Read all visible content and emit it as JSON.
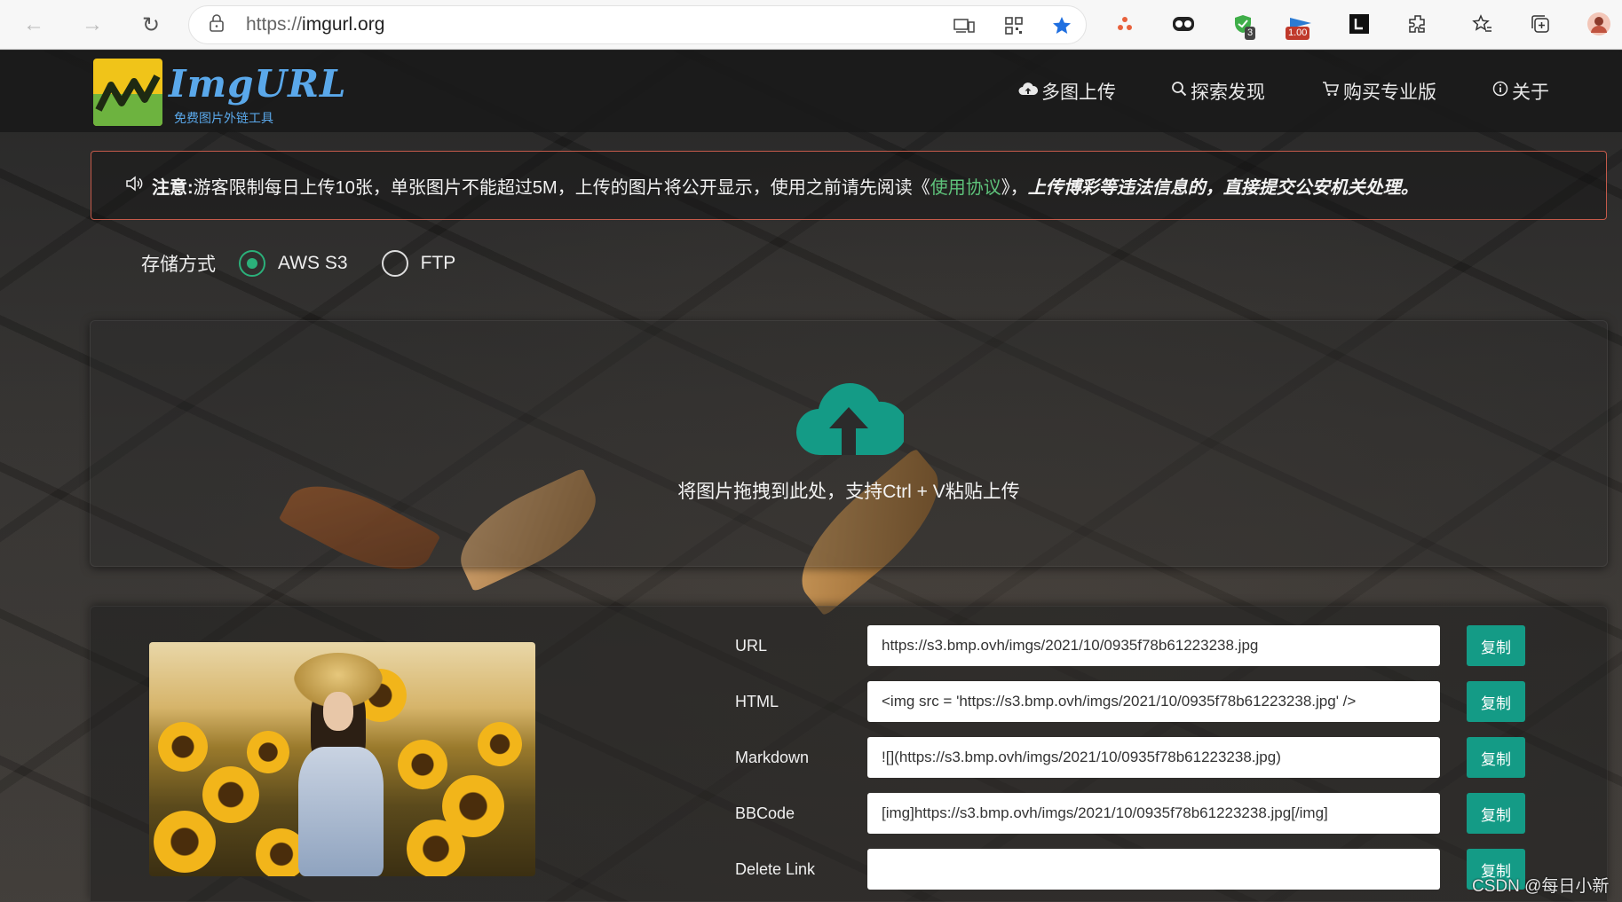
{
  "browser": {
    "url_protocol": "https://",
    "url_host": "imgurl.org",
    "extension_badge_count": "3",
    "extension_badge_zoom": "1.00"
  },
  "site": {
    "logo_title": "ImgURL",
    "logo_subtitle": "免费图片外链工具",
    "menu": {
      "multi_upload": "多图上传",
      "explore": "探索发现",
      "buy_pro": "购买专业版",
      "about": "关于"
    }
  },
  "notice": {
    "label": "注意:",
    "text_before": "游客限制每日上传10张，单张图片不能超过5M，上传的图片将公开显示，使用之前请先阅读《",
    "link": "使用协议",
    "text_after": "》，",
    "warning": "上传博彩等违法信息的，直接提交公安机关处理。"
  },
  "storage": {
    "label": "存储方式",
    "options": [
      "AWS S3",
      "FTP"
    ],
    "selected": "AWS S3"
  },
  "upload": {
    "hint": "将图片拖拽到此处，支持Ctrl + V粘贴上传"
  },
  "result": {
    "rows": [
      {
        "label": "URL",
        "value": "https://s3.bmp.ovh/imgs/2021/10/0935f78b61223238.jpg",
        "button": "复制"
      },
      {
        "label": "HTML",
        "value": "<img src = 'https://s3.bmp.ovh/imgs/2021/10/0935f78b61223238.jpg' />",
        "button": "复制"
      },
      {
        "label": "Markdown",
        "value": "![](https://s3.bmp.ovh/imgs/2021/10/0935f78b61223238.jpg)",
        "button": "复制"
      },
      {
        "label": "BBCode",
        "value": "[img]https://s3.bmp.ovh/imgs/2021/10/0935f78b61223238.jpg[/img]",
        "button": "复制"
      },
      {
        "label": "Delete Link",
        "value": "",
        "button": "复制"
      }
    ]
  },
  "watermark": "CSDN @每日小新",
  "colors": {
    "accent": "#149b86",
    "radio_checked": "#2bb07a",
    "logo_blue": "#5aa8ea",
    "notice_border": "#c45a4a",
    "link_green": "#5ec27a"
  },
  "icons": [
    "back-arrow-icon",
    "forward-arrow-icon",
    "refresh-icon",
    "lock-icon",
    "devices-icon",
    "qr-icon",
    "star-icon",
    "extension-icon",
    "favorites-icon",
    "collections-icon",
    "profile-icon",
    "cloud-upload-icon",
    "search-icon",
    "cart-icon",
    "info-icon",
    "speaker-icon"
  ]
}
